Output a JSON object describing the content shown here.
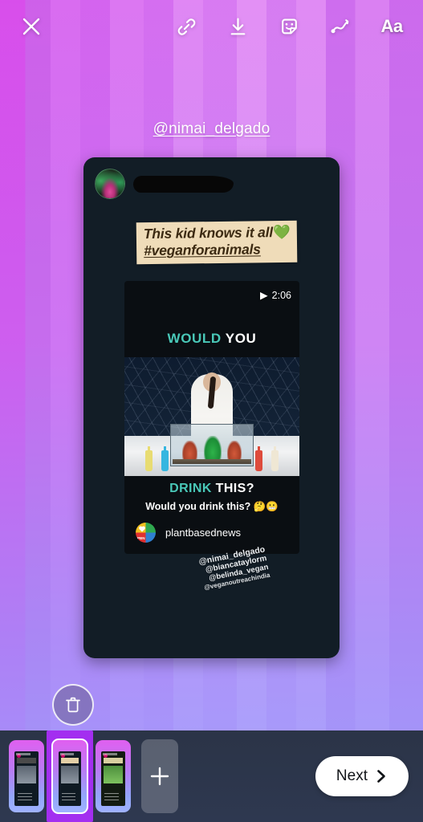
{
  "app": {
    "screen_name": "instagram-story-editor"
  },
  "toolbar": {
    "close_label": "✕",
    "text_tool_label": "Aa",
    "icons": [
      "close-icon",
      "link-icon",
      "download-icon",
      "sticker-icon",
      "draw-icon",
      "text-icon"
    ]
  },
  "story": {
    "handle": "@nimai_delgado",
    "post": {
      "username_redacted": "",
      "text_sticker": {
        "line1": "This kid knows it all",
        "emoji": "💚",
        "line2": "#veganforanimals"
      },
      "video": {
        "duration": "2:06",
        "play_icon": "▶",
        "title_part1": "WOULD",
        "title_part2": "YOU",
        "title2_part1": "DRINK",
        "title2_part2": "THIS?",
        "caption": "Would you drink this? 🤔😬",
        "account": "plantbasednews",
        "logo_text": "PBN"
      },
      "mentions": [
        "@nimai_delgado",
        "@biancataylorm",
        "@belinda_vegan",
        "@veganoutreachindia"
      ]
    }
  },
  "bottom": {
    "delete_label": "trash-icon",
    "add_label": "+",
    "next_label": "Next",
    "next_chevron": "❯",
    "thumbnails": [
      {
        "id": "story-1",
        "selected": false
      },
      {
        "id": "story-2",
        "selected": true
      },
      {
        "id": "story-3",
        "selected": false
      }
    ]
  },
  "colors": {
    "accent_purple": "#a32ef0",
    "card_dark": "#121d26",
    "sticker_cream": "#efdcb9",
    "teal": "#49c8b8",
    "bottom_bar": "#2b3447"
  }
}
